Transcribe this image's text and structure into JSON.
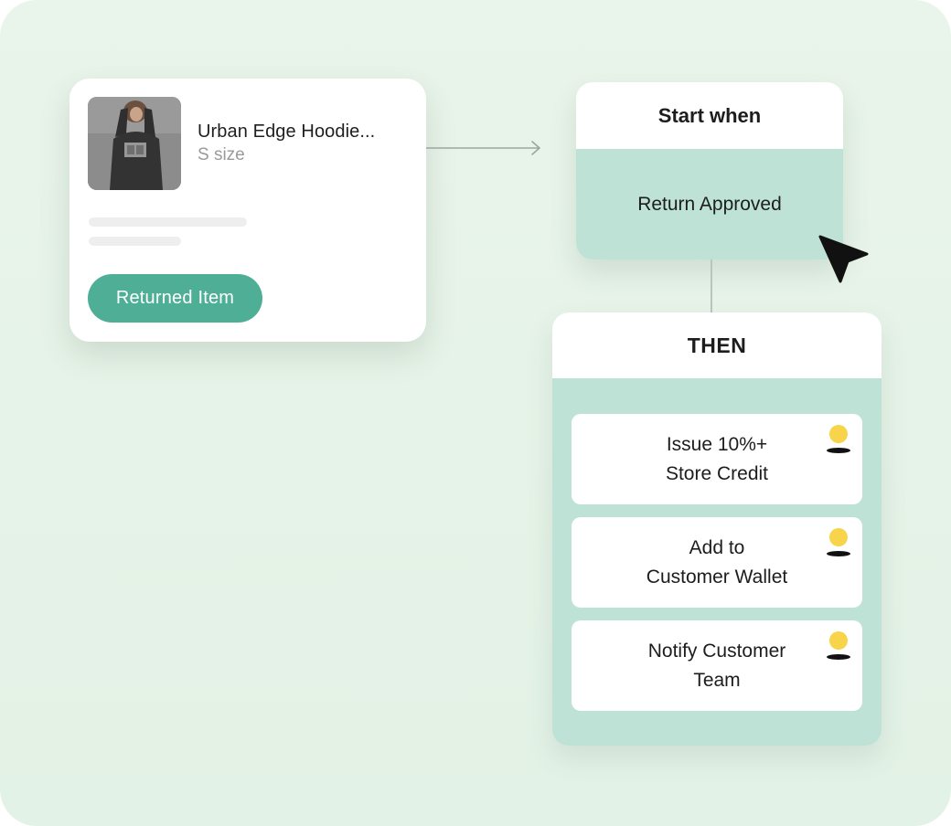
{
  "product": {
    "name": "Urban Edge Hoodie...",
    "size": "S size",
    "status_button": "Returned Item"
  },
  "trigger": {
    "header": "Start when",
    "condition": "Return Approved"
  },
  "then": {
    "header": "THEN",
    "actions": [
      {
        "label": "Issue 10%+\nStore Credit",
        "icon": "user-icon"
      },
      {
        "label": "Add to\nCustomer Wallet",
        "icon": "user-icon"
      },
      {
        "label": "Notify Customer\nTeam",
        "icon": "user-icon"
      }
    ]
  },
  "colors": {
    "background": "#e6f3e8",
    "accent_button": "#4eaf96",
    "panel_fill": "#bee2d6",
    "user_icon_head": "#f7d44a"
  }
}
